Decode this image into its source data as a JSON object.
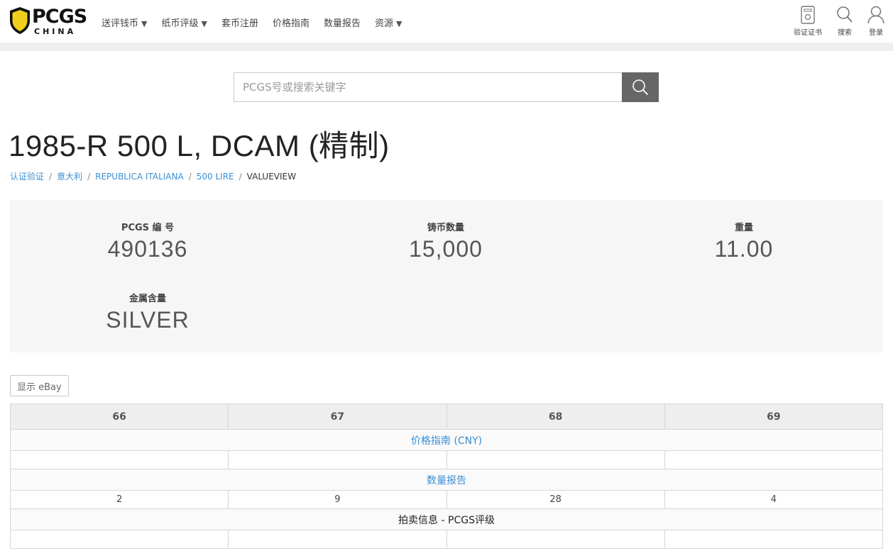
{
  "brand": {
    "logo_text": "PCGS",
    "logo_sub": "CHINA",
    "accent": "#e8c61e"
  },
  "nav": [
    {
      "label": "送评钱币",
      "has_menu": true
    },
    {
      "label": "纸币评级",
      "has_menu": true
    },
    {
      "label": "套币注册",
      "has_menu": false
    },
    {
      "label": "价格指南",
      "has_menu": false
    },
    {
      "label": "数量报告",
      "has_menu": false
    },
    {
      "label": "资源",
      "has_menu": true
    }
  ],
  "tools": {
    "verify": "验证证书",
    "search": "搜索",
    "login": "登录"
  },
  "search": {
    "placeholder": "PCGS号或搜索关键字"
  },
  "title": "1985-R 500 L, DCAM (精制)",
  "breadcrumb": {
    "items": [
      "认证验证",
      "意大利",
      "REPUBLICA ITALIANA",
      "500 LIRE"
    ],
    "current": "VALUEVIEW"
  },
  "stats": {
    "pcgs_no": {
      "label": "PCGS 编 号",
      "value": "490136"
    },
    "mintage": {
      "label": "铸币数量",
      "value": "15,000"
    },
    "weight": {
      "label": "重量",
      "value": "11.00"
    },
    "metal": {
      "label": "金属含量",
      "value": "SILVER"
    }
  },
  "ebay_button": "显示 eBay",
  "table": {
    "grades": [
      "66",
      "67",
      "68",
      "69"
    ],
    "price_guide_label": "价格指南 (CNY)",
    "price_values": [
      "",
      "",
      "",
      ""
    ],
    "pop_report_label": "数量报告",
    "pop_values": [
      "2",
      "9",
      "28",
      "4"
    ],
    "auction_label": "拍卖信息 - PCGS评级",
    "auction_values": [
      "",
      "",
      "",
      ""
    ]
  }
}
